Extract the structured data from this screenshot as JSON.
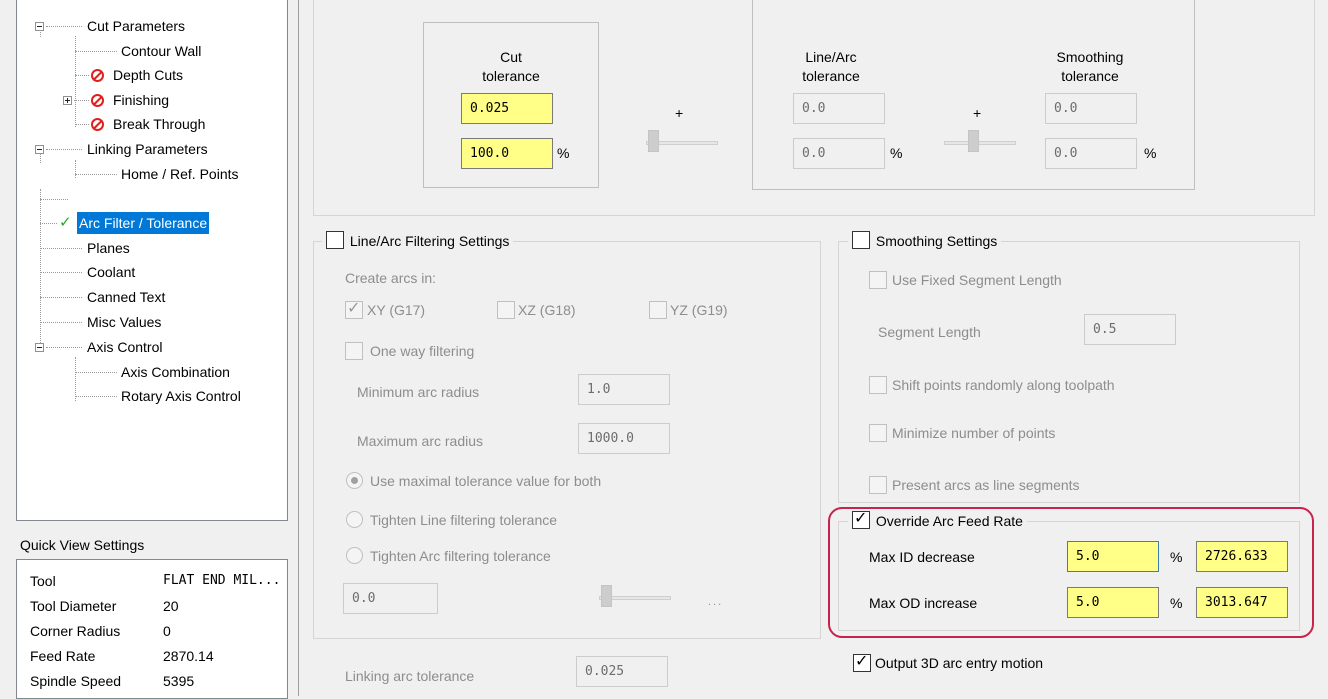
{
  "tree": {
    "items": [
      {
        "label": "Cut Parameters"
      },
      {
        "label": "Contour Wall"
      },
      {
        "label": "Depth Cuts"
      },
      {
        "label": "Finishing"
      },
      {
        "label": "Break Through"
      },
      {
        "label": "Linking Parameters"
      },
      {
        "label": "Home / Ref. Points"
      },
      {
        "label": "Arc Filter / Tolerance"
      },
      {
        "label": "Planes"
      },
      {
        "label": "Coolant"
      },
      {
        "label": "Canned Text"
      },
      {
        "label": "Misc Values"
      },
      {
        "label": "Axis Control"
      },
      {
        "label": "Axis Combination"
      },
      {
        "label": "Rotary Axis Control"
      }
    ],
    "selected": "Arc Filter / Tolerance"
  },
  "quick_view": {
    "title": "Quick View Settings",
    "rows": [
      {
        "label": "Tool",
        "value": "FLAT END MIL..."
      },
      {
        "label": "Tool Diameter",
        "value": "20"
      },
      {
        "label": "Corner Radius",
        "value": "0"
      },
      {
        "label": "Feed Rate",
        "value": "2870.14"
      },
      {
        "label": "Spindle Speed",
        "value": "5395"
      }
    ]
  },
  "tolerance": {
    "cut_label": "Cut\ntolerance",
    "cut_value": "0.025",
    "cut_percent": "100.0",
    "plus": "+",
    "percent_sign": "%",
    "line_arc_label": "Line/Arc\ntolerance",
    "line_arc_value": "0.0",
    "line_arc_percent": "0.0",
    "smoothing_label": "Smoothing\ntolerance",
    "smoothing_value": "0.0",
    "smoothing_percent": "0.0"
  },
  "line_arc": {
    "title": "Line/Arc Filtering Settings",
    "create_arcs_in": "Create arcs in:",
    "xy": "XY (G17)",
    "xz": "XZ (G18)",
    "yz": "YZ (G19)",
    "one_way": "One way filtering",
    "min_radius_label": "Minimum arc radius",
    "min_radius_value": "1.0",
    "max_radius_label": "Maximum arc radius",
    "max_radius_value": "1000.0",
    "radio_maximal": "Use maximal tolerance value for both",
    "radio_line": "Tighten Line filtering tolerance",
    "radio_arc": "Tighten Arc filtering tolerance",
    "tighten_value": "0.0",
    "ellipsis": "...",
    "linking_arc_label": "Linking arc tolerance",
    "linking_arc_value": "0.025"
  },
  "smoothing": {
    "title": "Smoothing Settings",
    "fixed_segment": "Use Fixed Segment Length",
    "segment_length_label": "Segment Length",
    "segment_length_value": "0.5",
    "shift_points": "Shift points randomly along toolpath",
    "minimize_points": "Minimize number of points",
    "present_arcs": "Present arcs as line segments"
  },
  "override": {
    "title": "Override Arc Feed Rate",
    "max_id_label": "Max ID decrease",
    "max_id_value": "5.0",
    "max_id_result": "2726.633",
    "max_od_label": "Max OD increase",
    "max_od_value": "5.0",
    "max_od_result": "3013.647",
    "percent": "%"
  },
  "output_3d": "Output 3D arc entry motion",
  "colors": {
    "selection": "#0078d7",
    "highlight": "#c8234a",
    "field_yellow": "#ffff88",
    "error_icon": "#e0201c",
    "check_icon": "#2aa52a"
  }
}
